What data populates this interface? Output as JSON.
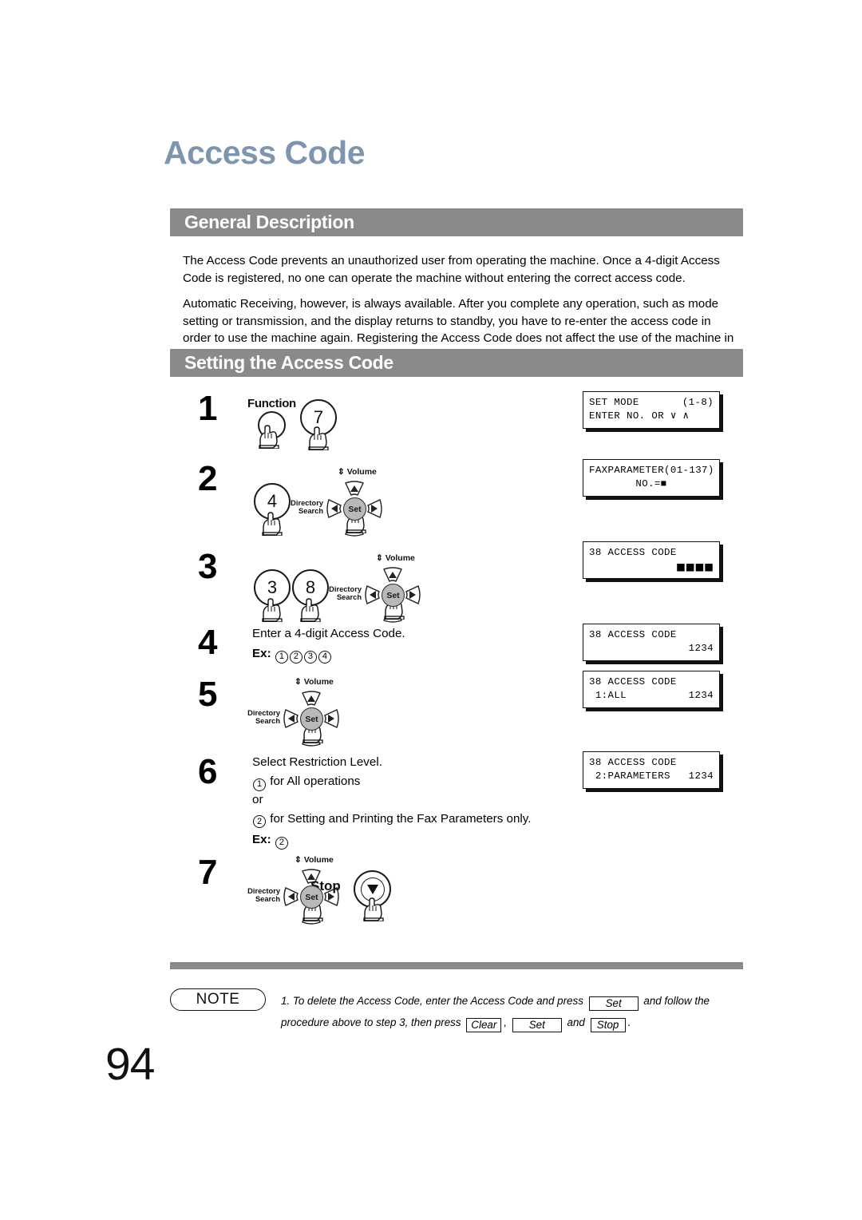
{
  "page": {
    "title": "Access Code",
    "number": "94",
    "title_color": "#7d95ae",
    "bar_color": "#8a8a8a"
  },
  "sections": [
    {
      "id": "general",
      "heading": "General Description"
    },
    {
      "id": "setting",
      "heading": "Setting the Access Code"
    }
  ],
  "paragraphs": {
    "p1": "The Access Code prevents an unauthorized user from operating the machine.  Once a 4-digit Access Code is registered, no one can operate the machine without entering the correct access code.",
    "p2": "Automatic Receiving, however, is always available.  After you complete any operation, such as mode setting or transmission, and the display returns to standby, you have to re-enter the access code in order to use the machine again.  Registering the Access Code does not affect the use of the machine in any other way."
  },
  "steps": {
    "s1": {
      "num": "1",
      "function_label": "Function",
      "key": "7"
    },
    "s2": {
      "num": "2",
      "key": "4"
    },
    "s3": {
      "num": "3",
      "key1": "3",
      "key2": "8"
    },
    "s4": {
      "num": "4",
      "text": "Enter a 4-digit Access Code.",
      "ex_label": "Ex:",
      "ex_digits": [
        "1",
        "2",
        "3",
        "4"
      ]
    },
    "s5": {
      "num": "5"
    },
    "s6": {
      "num": "6",
      "text": "Select Restriction Level.",
      "option1_digit": "1",
      "option1_text": "for All operations",
      "or": "or",
      "option2_digit": "2",
      "option2_text": "for Setting and Printing the Fax Parameters only.",
      "ex_label": "Ex:",
      "ex_digit": "2"
    },
    "s7": {
      "num": "7",
      "stop_label": "Stop"
    }
  },
  "navpad": {
    "volume_label": "Volume",
    "directory_line1": "Directory",
    "directory_line2": "Search",
    "set_label": "Set"
  },
  "lcds": [
    {
      "id": "lcd1",
      "line1_left": "SET MODE",
      "line1_right": "(1-8)",
      "line2_left": "ENTER NO. OR ∨ ∧",
      "line2_right": ""
    },
    {
      "id": "lcd2",
      "line1_left": "FAXPARAMETER(01-137)",
      "line1_right": "",
      "line2_center": "NO.=■"
    },
    {
      "id": "lcd3",
      "line1_left": "38 ACCESS CODE",
      "line1_right": "",
      "line2_left": "",
      "line2_right": "■■■■"
    },
    {
      "id": "lcd4",
      "line1_left": "38 ACCESS CODE",
      "line1_right": "",
      "line2_left": "",
      "line2_right": "1234"
    },
    {
      "id": "lcd5",
      "line1_left": "38 ACCESS CODE",
      "line1_right": "",
      "line2_left": " 1:ALL",
      "line2_right": "1234"
    },
    {
      "id": "lcd6",
      "line1_left": "38 ACCESS CODE",
      "line1_right": "",
      "line2_left": " 2:PARAMETERS",
      "line2_right": "1234"
    }
  ],
  "note": {
    "badge": "NOTE",
    "item_number": "1.",
    "text_a": "To delete the Access Code, enter the Access Code and press",
    "key_set_1": "Set",
    "text_b": "and follow the",
    "text_c": "procedure above to step 3, then press",
    "key_clear": "Clear",
    "comma": ",",
    "key_set_2": "Set",
    "text_d": "and",
    "key_stop": "Stop",
    "period": "."
  }
}
